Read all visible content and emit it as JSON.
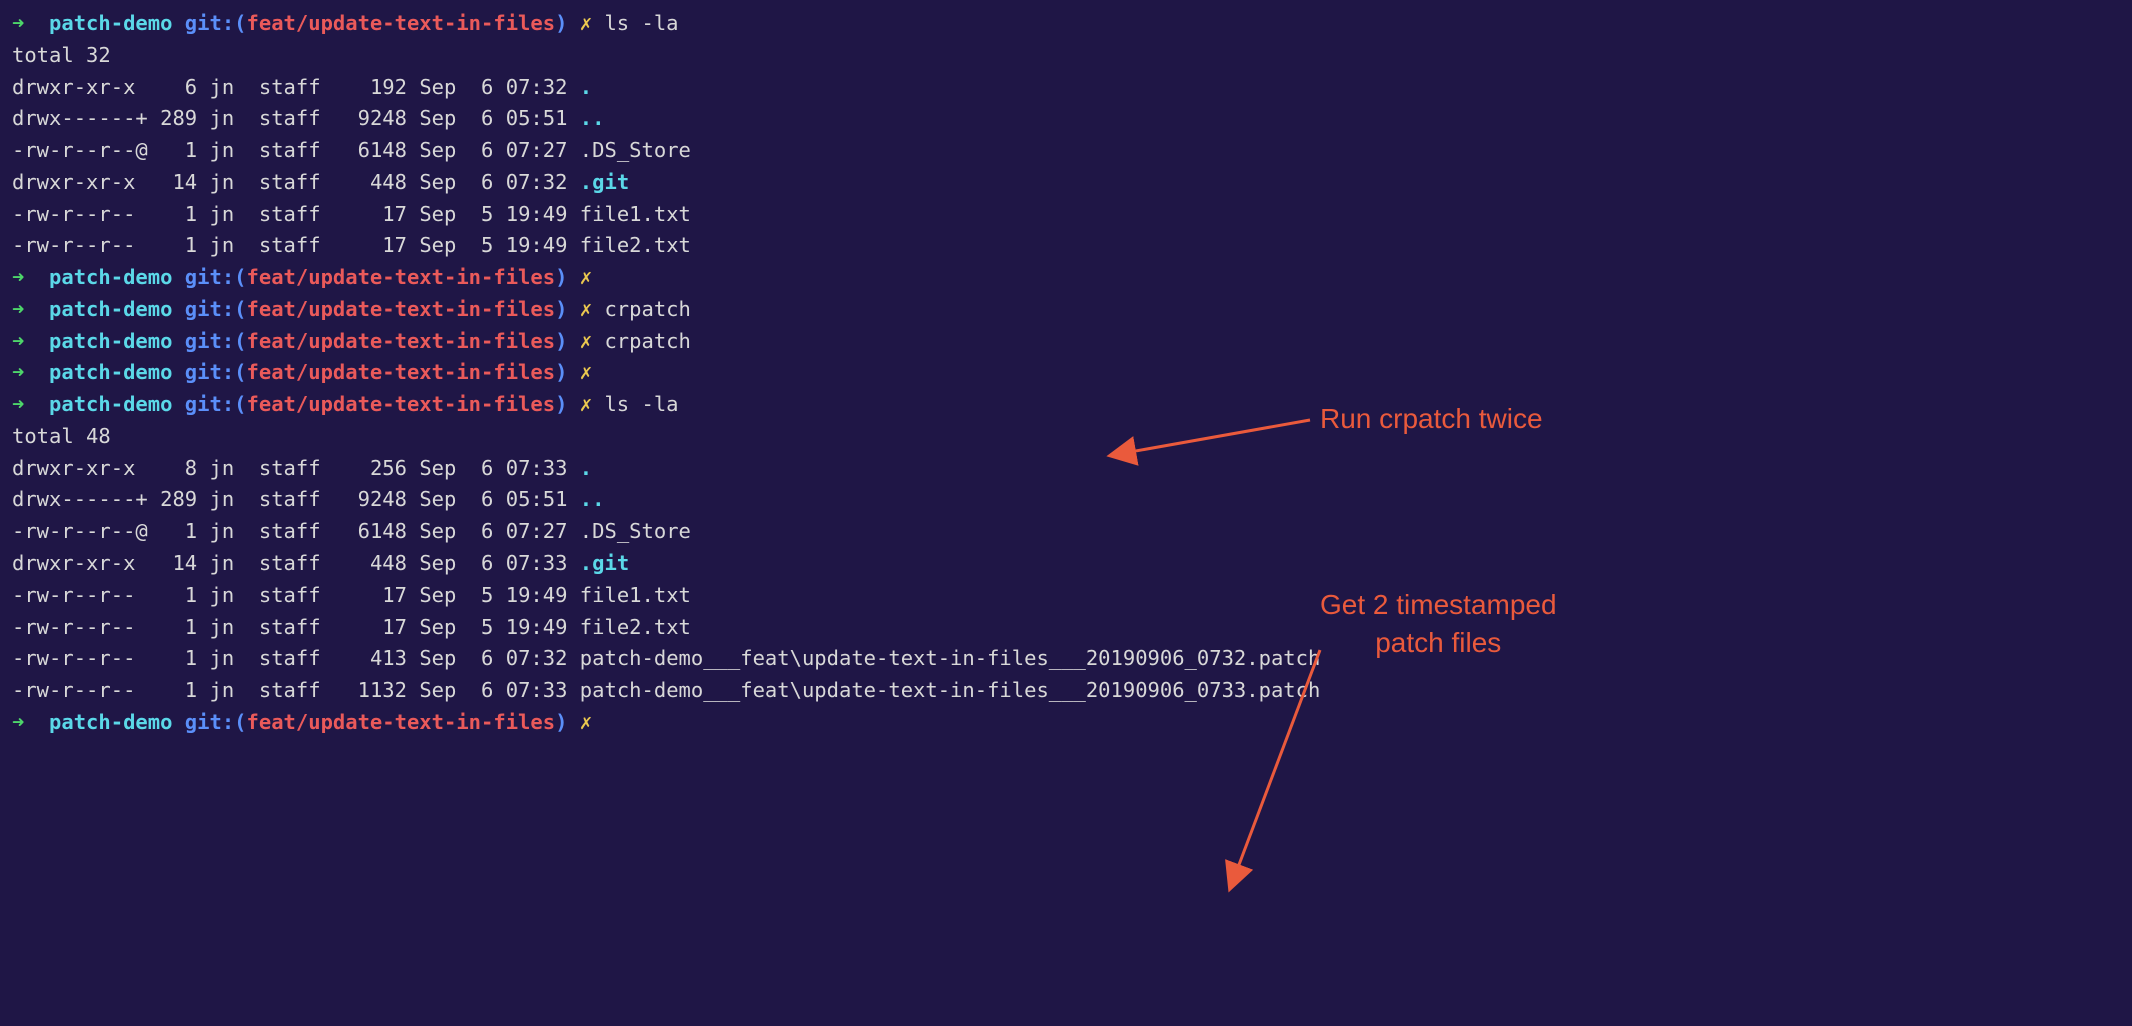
{
  "prompt": {
    "arrow": "➜ ",
    "dir": " patch-demo ",
    "git": "git:",
    "open": "(",
    "branch": "feat/update-text-in-files",
    "close": ")",
    "x": " ✗"
  },
  "cmds": {
    "ls": " ls -la",
    "empty": "",
    "crpatch": " crpatch"
  },
  "listing1": {
    "total": "total 32",
    "rows": [
      {
        "perm": "drwxr-xr-x ",
        "n": "   6",
        "u": " jn ",
        "g": " staff ",
        "sz": "   192",
        "m": " Sep ",
        "d": " 6",
        "t": " 07:32 ",
        "f": ".",
        "cls": "hidden-dir"
      },
      {
        "perm": "drwx------+",
        "n": " 289",
        "u": " jn ",
        "g": " staff ",
        "sz": "  9248",
        "m": " Sep ",
        "d": " 6",
        "t": " 05:51 ",
        "f": "..",
        "cls": "hidden-dir"
      },
      {
        "perm": "-rw-r--r--@",
        "n": "   1",
        "u": " jn ",
        "g": " staff ",
        "sz": "  6148",
        "m": " Sep ",
        "d": " 6",
        "t": " 07:27 ",
        "f": ".DS_Store",
        "cls": "plain"
      },
      {
        "perm": "drwxr-xr-x ",
        "n": "  14",
        "u": " jn ",
        "g": " staff ",
        "sz": "   448",
        "m": " Sep ",
        "d": " 6",
        "t": " 07:32 ",
        "f": ".git",
        "cls": "hidden-dir"
      },
      {
        "perm": "-rw-r--r-- ",
        "n": "   1",
        "u": " jn ",
        "g": " staff ",
        "sz": "    17",
        "m": " Sep ",
        "d": " 5",
        "t": " 19:49 ",
        "f": "file1.txt",
        "cls": "plain"
      },
      {
        "perm": "-rw-r--r-- ",
        "n": "   1",
        "u": " jn ",
        "g": " staff ",
        "sz": "    17",
        "m": " Sep ",
        "d": " 5",
        "t": " 19:49 ",
        "f": "file2.txt",
        "cls": "plain"
      }
    ]
  },
  "listing2": {
    "total": "total 48",
    "rows": [
      {
        "perm": "drwxr-xr-x ",
        "n": "   8",
        "u": " jn ",
        "g": " staff ",
        "sz": "   256",
        "m": " Sep ",
        "d": " 6",
        "t": " 07:33 ",
        "f": ".",
        "cls": "hidden-dir"
      },
      {
        "perm": "drwx------+",
        "n": " 289",
        "u": " jn ",
        "g": " staff ",
        "sz": "  9248",
        "m": " Sep ",
        "d": " 6",
        "t": " 05:51 ",
        "f": "..",
        "cls": "hidden-dir"
      },
      {
        "perm": "-rw-r--r--@",
        "n": "   1",
        "u": " jn ",
        "g": " staff ",
        "sz": "  6148",
        "m": " Sep ",
        "d": " 6",
        "t": " 07:27 ",
        "f": ".DS_Store",
        "cls": "plain"
      },
      {
        "perm": "drwxr-xr-x ",
        "n": "  14",
        "u": " jn ",
        "g": " staff ",
        "sz": "   448",
        "m": " Sep ",
        "d": " 6",
        "t": " 07:33 ",
        "f": ".git",
        "cls": "hidden-dir"
      },
      {
        "perm": "-rw-r--r-- ",
        "n": "   1",
        "u": " jn ",
        "g": " staff ",
        "sz": "    17",
        "m": " Sep ",
        "d": " 5",
        "t": " 19:49 ",
        "f": "file1.txt",
        "cls": "plain"
      },
      {
        "perm": "-rw-r--r-- ",
        "n": "   1",
        "u": " jn ",
        "g": " staff ",
        "sz": "    17",
        "m": " Sep ",
        "d": " 5",
        "t": " 19:49 ",
        "f": "file2.txt",
        "cls": "plain"
      },
      {
        "perm": "-rw-r--r-- ",
        "n": "   1",
        "u": " jn ",
        "g": " staff ",
        "sz": "   413",
        "m": " Sep ",
        "d": " 6",
        "t": " 07:32 ",
        "f": "patch-demo___feat\\update-text-in-files___20190906_0732.patch",
        "cls": "plain"
      },
      {
        "perm": "-rw-r--r-- ",
        "n": "   1",
        "u": " jn ",
        "g": " staff ",
        "sz": "  1132",
        "m": " Sep ",
        "d": " 6",
        "t": " 07:33 ",
        "f": "patch-demo___feat\\update-text-in-files___20190906_0733.patch",
        "cls": "plain"
      }
    ]
  },
  "annotations": {
    "a1": "Run crpatch twice",
    "a2": "Get 2 timestamped\npatch files"
  }
}
